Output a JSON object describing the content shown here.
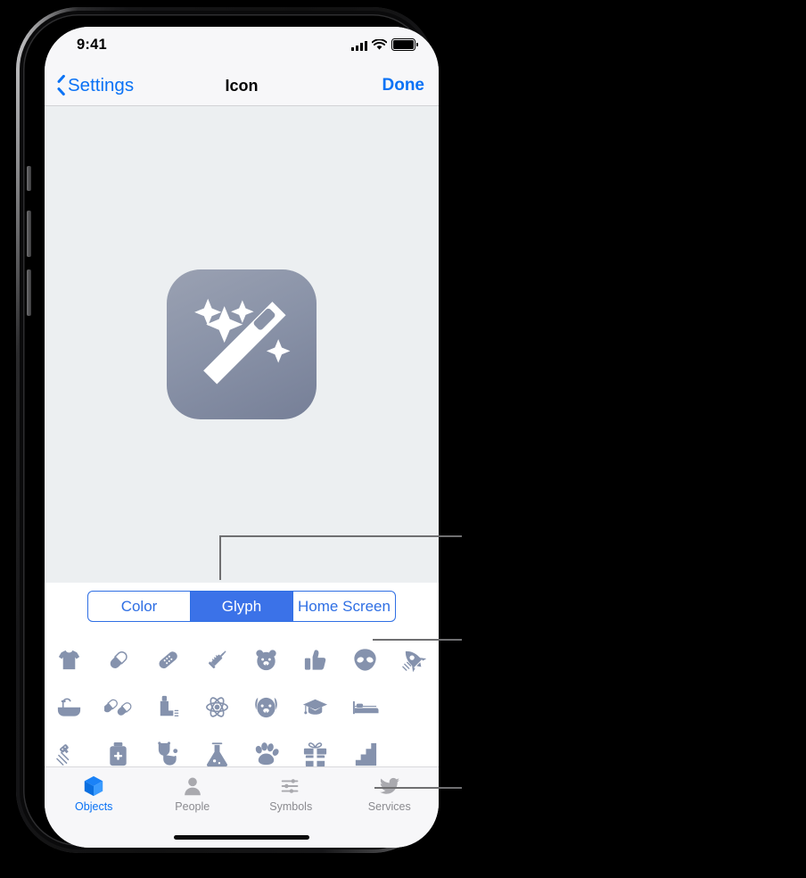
{
  "device": {
    "status_bar": {
      "time": "9:41",
      "cellular_icon": "signal-bars-icon",
      "wifi_icon": "wifi-icon",
      "battery_icon": "battery-icon"
    },
    "home_indicator": "home-indicator"
  },
  "navbar": {
    "back_label": "Settings",
    "title": "Icon",
    "done_label": "Done",
    "accent_color": "#0a72f5"
  },
  "preview": {
    "icon_name": "magic-wand-app-icon",
    "background_color": "#eceff1",
    "icon_gradient_start": "#9aa1b2",
    "icon_gradient_end": "#767f97"
  },
  "segmented_control": {
    "selected": "Glyph",
    "accent_color": "#3b72e8",
    "options": [
      {
        "label": "Color",
        "selected": false
      },
      {
        "label": "Glyph",
        "selected": true
      },
      {
        "label": "Home Screen",
        "selected": false
      }
    ]
  },
  "glyph_grid": {
    "glyph_color": "#8592ad",
    "rows": [
      [
        {
          "name": "tshirt-glyph"
        },
        {
          "name": "capsule-pill-glyph"
        },
        {
          "name": "bandage-glyph"
        },
        {
          "name": "syringe-glyph"
        },
        {
          "name": "bear-face-glyph"
        },
        {
          "name": "thumbs-up-glyph"
        },
        {
          "name": "alien-glyph"
        },
        {
          "name": "rocket-glyph"
        }
      ],
      [
        {
          "name": "bathtub-glyph"
        },
        {
          "name": "pills-glyph"
        },
        {
          "name": "inhaler-glyph"
        },
        {
          "name": "atom-glyph"
        },
        {
          "name": "dog-face-glyph"
        },
        {
          "name": "graduation-cap-glyph"
        },
        {
          "name": "bed-glyph"
        }
      ],
      [
        {
          "name": "shower-glyph"
        },
        {
          "name": "medicine-bottle-glyph"
        },
        {
          "name": "stethoscope-glyph"
        },
        {
          "name": "flask-glyph"
        },
        {
          "name": "paw-print-glyph"
        },
        {
          "name": "gift-glyph"
        },
        {
          "name": "stairs-glyph"
        }
      ]
    ]
  },
  "tab_bar": {
    "active_color": "#0a72f5",
    "inactive_color": "#8b8b90",
    "tabs": [
      {
        "label": "Objects",
        "icon": "cube-icon",
        "selected": true
      },
      {
        "label": "People",
        "icon": "person-icon",
        "selected": false
      },
      {
        "label": "Symbols",
        "icon": "sliders-icon",
        "selected": false
      },
      {
        "label": "Services",
        "icon": "bird-icon",
        "selected": false
      }
    ]
  },
  "callouts": {
    "line_color": "#6f6f71",
    "items": [
      {
        "name": "callout-segmented-control"
      },
      {
        "name": "callout-glyph-grid"
      },
      {
        "name": "callout-tab-bar"
      }
    ]
  }
}
